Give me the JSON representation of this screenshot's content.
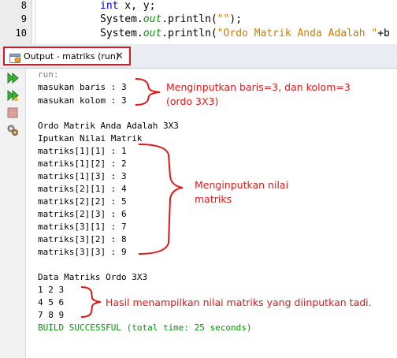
{
  "editor": {
    "line_numbers": [
      "8",
      "9",
      "10"
    ],
    "line8": {
      "kw": "int",
      "rest": " x, y;"
    },
    "line9": {
      "prefix": "System.",
      "field": "out",
      "method": ".println(",
      "str": "\"\"",
      "suffix": ");"
    },
    "line10": {
      "prefix": "System.",
      "field": "out",
      "method": ".println(",
      "str": "\"Ordo Matrik Anda Adalah \"",
      "suffix": "+b"
    }
  },
  "output_tab": {
    "title": "Output - matriks (run)",
    "close": "✕"
  },
  "toolbar": {
    "buttons": [
      "rerun-icon",
      "rerun-with-options-icon",
      "stop-icon",
      "settings-icon"
    ]
  },
  "output": {
    "lines": [
      "run:",
      "masukan baris : 3",
      "masukan kolom : 3",
      "",
      "Ordo Matrik Anda Adalah 3X3",
      "Iputkan Nilai Matrik",
      "matriks[1][1] : 1",
      "matriks[1][2] : 2",
      "matriks[1][3] : 3",
      "matriks[2][1] : 4",
      "matriks[2][2] : 5",
      "matriks[2][3] : 6",
      "matriks[3][1] : 7",
      "matriks[3][2] : 8",
      "matriks[3][3] : 9",
      "",
      "Data Matriks Ordo 3X3",
      "1 2 3",
      "4 5 6",
      "7 8 9",
      "BUILD SUCCESSFUL (total time: 25 seconds)"
    ]
  },
  "annotations": {
    "a1_line1": "Menginputkan baris=3, dan kolom=3",
    "a1_line2": "(ordo 3X3)",
    "a2_line1": "Menginputkan nilai",
    "a2_line2": "matriks",
    "a3": "Hasil menampilkan nilai matriks yang diinputkan tadi."
  },
  "colors": {
    "annotation": "#e01818",
    "tab_highlight": "#e0141b",
    "build_success": "#009900"
  }
}
